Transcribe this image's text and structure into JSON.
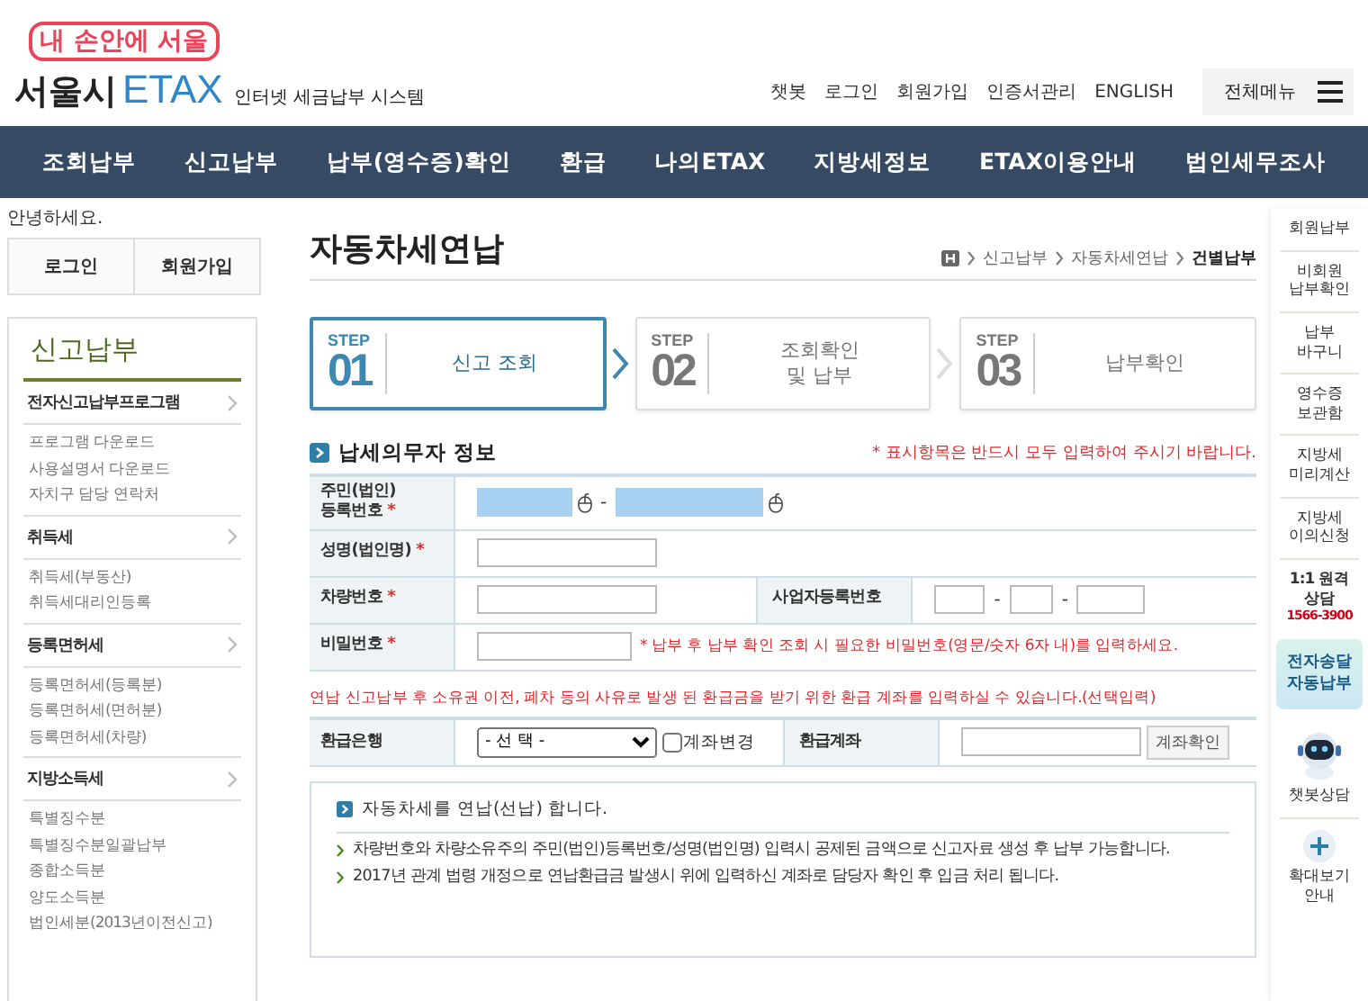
{
  "header": {
    "tagline": "내 손안에 서울",
    "city": "서울시",
    "brand": "ETAX",
    "subtitle": "인터넷 세금납부 시스템",
    "util_links": [
      "챗봇",
      "로그인",
      "회원가입",
      "인증서관리",
      "ENGLISH"
    ],
    "all_menu": "전체메뉴"
  },
  "nav": [
    "조회납부",
    "신고납부",
    "납부(영수증)확인",
    "환급",
    "나의ETAX",
    "지방세정보",
    "ETAX이용안내",
    "법인세무조사"
  ],
  "sidebar": {
    "greeting": "안녕하세요.",
    "buttons": [
      "로그인",
      "회원가입"
    ],
    "title": "신고납부",
    "sections": [
      {
        "title": "전자신고납부프로그램",
        "items": [
          "프로그램 다운로드",
          "사용설명서 다운로드",
          "자치구 담당 연락처"
        ]
      },
      {
        "title": "취득세",
        "items": [
          "취득세(부동산)",
          "취득세대리인등록"
        ]
      },
      {
        "title": "등록면허세",
        "items": [
          "등록면허세(등록분)",
          "등록면허세(면허분)",
          "등록면허세(차량)"
        ]
      },
      {
        "title": "지방소득세",
        "items": [
          "특별징수분",
          "특별징수분일괄납부",
          "종합소득분",
          "양도소득분",
          "법인세분(2013년이전신고)"
        ]
      }
    ]
  },
  "page": {
    "title": "자동차세연납",
    "breadcrumb": [
      "신고납부",
      "자동차세연납",
      "건별납부"
    ]
  },
  "steps": [
    {
      "label": "STEP",
      "number": "01",
      "lines": [
        "신고 조회"
      ],
      "selected": true
    },
    {
      "label": "STEP",
      "number": "02",
      "lines": [
        "조회확인",
        "및 납부"
      ],
      "selected": false
    },
    {
      "label": "STEP",
      "number": "03",
      "lines": [
        "납부확인"
      ],
      "selected": false
    }
  ],
  "taxpayer": {
    "title": "납세의무자 정보",
    "required_note": "* 표시항목은 반드시 모두 입력하여 주시기 바랍니다.",
    "rows": [
      {
        "kind": "rrn",
        "label": [
          "주민(법인)",
          "등록번호"
        ],
        "required_mark": "*",
        "separator": "-"
      },
      {
        "kind": "text",
        "label": [
          "성명(법인명)"
        ],
        "required_mark": "*"
      },
      {
        "kind": "split",
        "label": [
          "차량번호"
        ],
        "required_mark": "*",
        "label2": "사업자등록번호",
        "separator": "-"
      },
      {
        "kind": "password",
        "label": [
          "비밀번호"
        ],
        "required_mark": "*",
        "hint": "* 납부 후 납부 확인 조회 시 필요한 비밀번호(영문/숫자 6자 내)를 입력하세요."
      }
    ]
  },
  "refund": {
    "note": "연납 신고납부 후 소유권 이전, 폐차 등의 사유로 발생 된 환급금을 받기 위한 환급 계좌를 입력하실 수 있습니다.(선택입력)",
    "bank_label": "환급은행",
    "bank_select": "- 선 택 -",
    "change_label": "계좌변경",
    "change_checked": false,
    "account_label": "환급계좌",
    "verify_button": "계좌확인"
  },
  "info": {
    "title": "자동차세를 연납(선납) 합니다.",
    "bullets": [
      "차량번호와 차량소유주의 주민(법인)등록번호/성명(법인명) 입력시 공제된 금액으로 신고자료 생성 후 납부 가능합니다.",
      "2017년 관계 법령 개정으로 연납환급금 발생시 위에 입력하신 계좌로 담당자 확인 후 입금 처리 됩니다."
    ]
  },
  "quickbar": [
    {
      "kind": "link",
      "lines": [
        "회원납부"
      ]
    },
    {
      "kind": "link",
      "lines": [
        "비회원",
        "납부확인"
      ]
    },
    {
      "kind": "link",
      "lines": [
        "납부",
        "바구니"
      ]
    },
    {
      "kind": "link",
      "lines": [
        "영수증",
        "보관함"
      ]
    },
    {
      "kind": "link",
      "lines": [
        "지방세",
        "미리계산"
      ]
    },
    {
      "kind": "link",
      "lines": [
        "지방세",
        "이의신청"
      ]
    },
    {
      "kind": "phone",
      "lines": [
        "1:1 원격",
        "상담"
      ],
      "phone": "1566-3900"
    },
    {
      "kind": "promo",
      "lines": [
        "전자송달",
        "자동납부"
      ]
    },
    {
      "kind": "chatbot",
      "lines": [
        "챗봇상담"
      ]
    },
    {
      "kind": "zoom",
      "lines": [
        "확대보기",
        "안내"
      ]
    }
  ]
}
